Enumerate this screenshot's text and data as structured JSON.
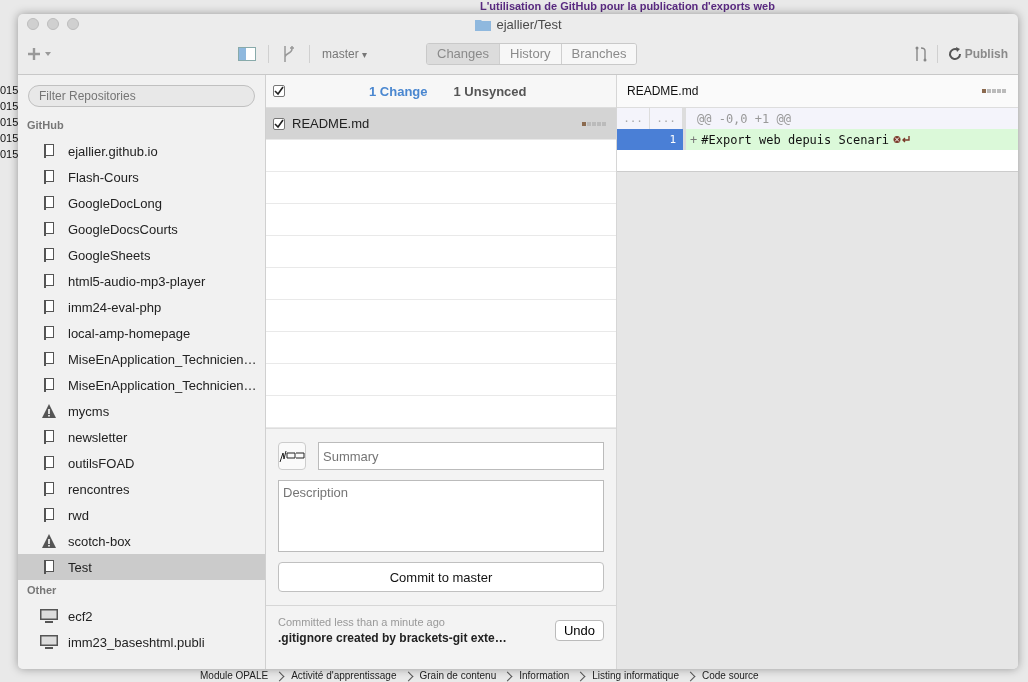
{
  "background": {
    "page_title": "L'utilisation de GitHub pour la publication d'exports web",
    "left_texts": [
      "015",
      "015",
      "015",
      "015",
      "015"
    ],
    "breadcrumb": [
      "Module OPALE",
      "Activité d'apprentissage",
      "Grain de contenu",
      "Information",
      "Listing informatique",
      "Code source"
    ]
  },
  "window": {
    "title": "ejallier/Test"
  },
  "toolbar": {
    "branch": "master",
    "branch_caret": "▾",
    "tabs": [
      {
        "label": "Changes",
        "selected": true
      },
      {
        "label": "History",
        "selected": false
      },
      {
        "label": "Branches",
        "selected": false
      }
    ],
    "publish": "Publish"
  },
  "sidebar": {
    "filter_placeholder": "Filter Repositories",
    "groups": [
      {
        "title": "GitHub",
        "items": [
          {
            "label": "ejallier.github.io",
            "kind": "repo",
            "selected": false
          },
          {
            "label": "Flash-Cours",
            "kind": "repo",
            "selected": false
          },
          {
            "label": "GoogleDocLong",
            "kind": "repo",
            "selected": false
          },
          {
            "label": "GoogleDocsCourts",
            "kind": "repo",
            "selected": false
          },
          {
            "label": "GoogleSheets",
            "kind": "repo",
            "selected": false
          },
          {
            "label": "html5-audio-mp3-player",
            "kind": "repo",
            "selected": false
          },
          {
            "label": "imm24-eval-php",
            "kind": "repo",
            "selected": false
          },
          {
            "label": "local-amp-homepage",
            "kind": "repo",
            "selected": false
          },
          {
            "label": "MiseEnApplication_Technicien…",
            "kind": "repo",
            "selected": false
          },
          {
            "label": "MiseEnApplication_Technicien…",
            "kind": "repo",
            "selected": false
          },
          {
            "label": "mycms",
            "kind": "warning",
            "selected": false
          },
          {
            "label": "newsletter",
            "kind": "repo",
            "selected": false
          },
          {
            "label": "outilsFOAD",
            "kind": "repo",
            "selected": false
          },
          {
            "label": "rencontres",
            "kind": "repo",
            "selected": false
          },
          {
            "label": "rwd",
            "kind": "repo",
            "selected": false
          },
          {
            "label": "scotch-box",
            "kind": "warning",
            "selected": false
          },
          {
            "label": "Test",
            "kind": "repo",
            "selected": true
          }
        ]
      },
      {
        "title": "Other",
        "items": [
          {
            "label": "ecf2",
            "kind": "computer",
            "selected": false
          },
          {
            "label": "imm23_baseshtml.publi",
            "kind": "computer",
            "selected": false
          }
        ]
      }
    ]
  },
  "changes": {
    "all_checked": true,
    "header_tabs": [
      {
        "label": "1 Change",
        "selected": true
      },
      {
        "label": "1 Unsynced",
        "selected": false
      }
    ],
    "files": [
      {
        "name": "README.md",
        "checked": true,
        "selected": true
      }
    ],
    "summary_placeholder": "Summary",
    "description_placeholder": "Description",
    "commit_button": "Commit to master",
    "last_commit": {
      "time": "Committed less than a minute ago",
      "message": ".gitignore created by brackets-git exte…",
      "undo": "Undo"
    }
  },
  "diff": {
    "file": "README.md",
    "hunk": {
      "old": "...",
      "new": "...",
      "text": "@@ -0,0 +1 @@"
    },
    "lines": [
      {
        "new": "1",
        "sign": "+",
        "text": "#Export web depuis Scenari",
        "kind": "added",
        "selected": true
      }
    ]
  }
}
